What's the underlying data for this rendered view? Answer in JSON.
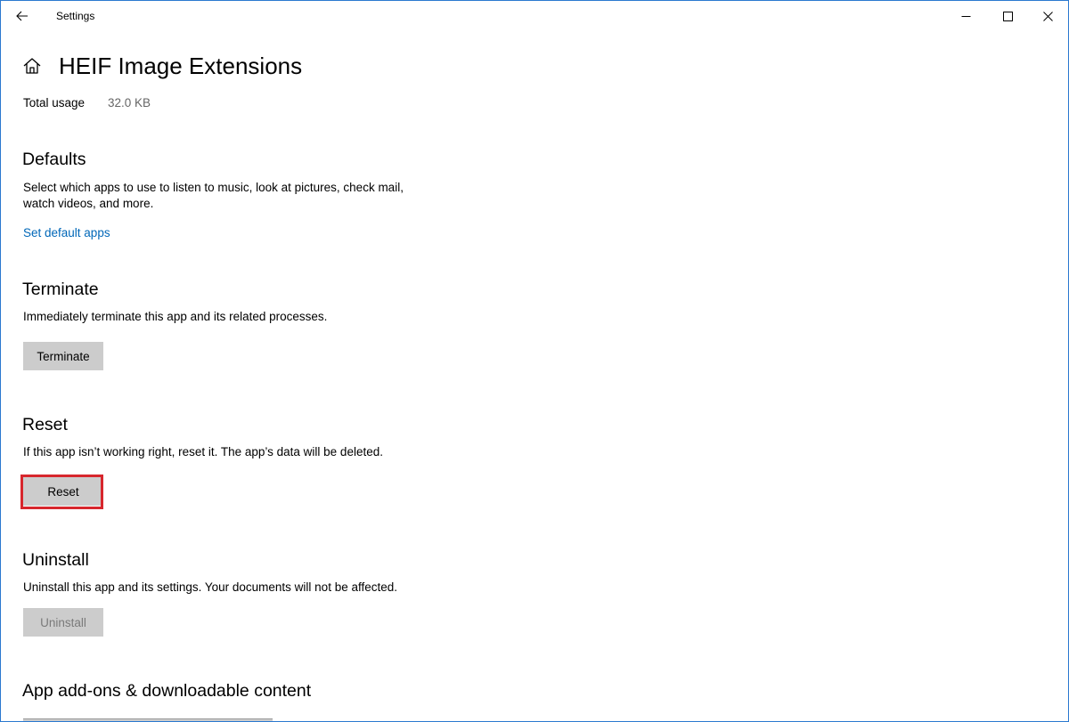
{
  "window": {
    "title": "Settings",
    "accent_color": "#2b79d0"
  },
  "icons": {
    "back": "back-arrow-icon",
    "minimize": "minimize-icon",
    "maximize": "maximize-icon",
    "close": "close-icon",
    "home": "home-icon"
  },
  "header": {
    "page_title": "HEIF Image Extensions",
    "usage_label": "Total usage",
    "usage_value": "32.0 KB"
  },
  "defaults": {
    "heading": "Defaults",
    "description": "Select which apps to use to listen to music, look at pictures, check mail, watch videos, and more.",
    "link_label": "Set default apps",
    "link_color": "#0067b8"
  },
  "terminate": {
    "heading": "Terminate",
    "description": "Immediately terminate this app and its related processes.",
    "button_label": "Terminate"
  },
  "reset": {
    "heading": "Reset",
    "description": "If this app isn’t working right, reset it. The app’s data will be deleted.",
    "button_label": "Reset",
    "highlight_color": "#d7262d"
  },
  "uninstall": {
    "heading": "Uninstall",
    "description": "Uninstall this app and its settings. Your documents will not be affected.",
    "button_label": "Uninstall",
    "button_enabled": false
  },
  "addons": {
    "heading": "App add-ons & downloadable content"
  }
}
